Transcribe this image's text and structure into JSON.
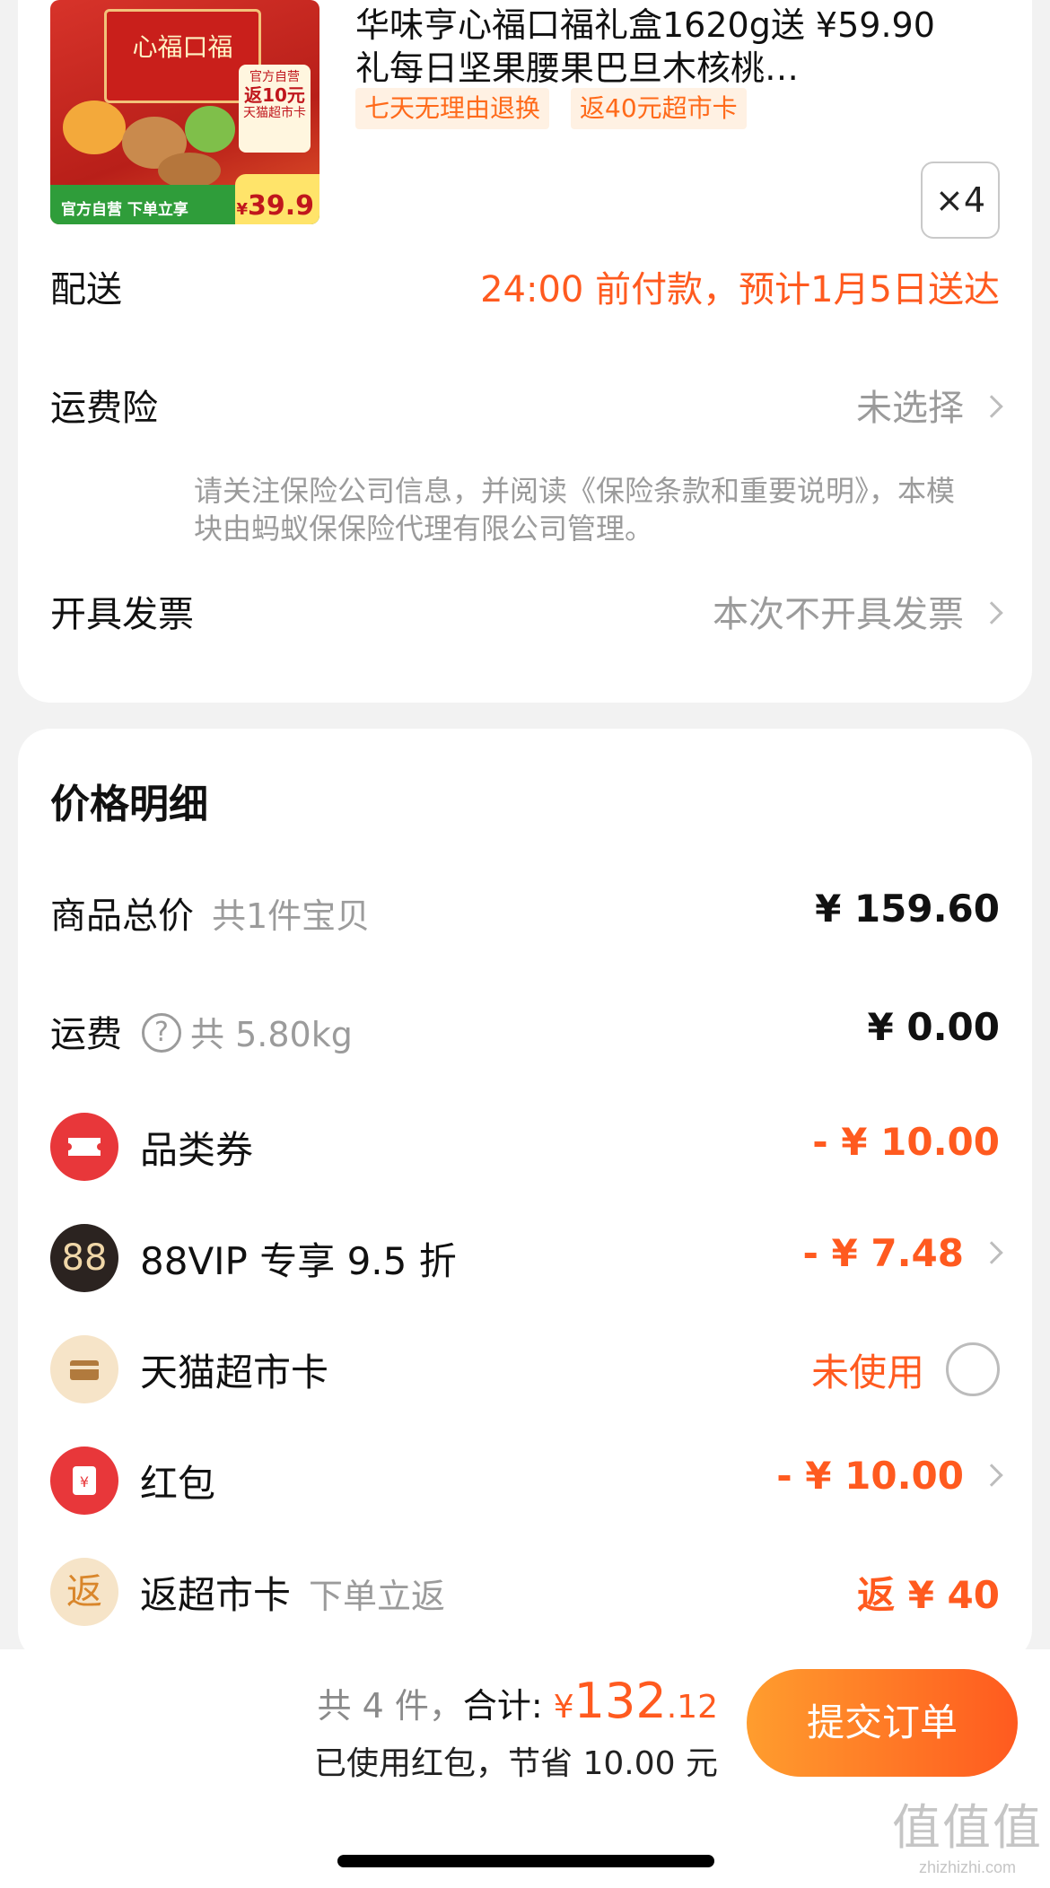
{
  "product": {
    "title_line1": "华味亨心福口福礼盒1620g送 ¥59.90",
    "title_line2": "礼每日坚果腰果巴旦木核桃…",
    "tags": [
      "七天无理由退换",
      "返40元超市卡"
    ],
    "quantity": "×4",
    "image": {
      "box_text": "心福口福",
      "badge_line1": "官方自营",
      "badge_line2": "返10元",
      "badge_line3": "天猫超市卡",
      "banner": "官方自营 下单立享",
      "price": "39.9",
      "currency": "¥"
    }
  },
  "delivery": {
    "label": "配送",
    "value": "24:00 前付款，预计1月5日送达"
  },
  "insurance": {
    "label": "运费险",
    "value": "未选择",
    "note": "请关注保险公司信息，并阅读《保险条款和重要说明》，本模块由蚂蚁保保险代理有限公司管理。"
  },
  "invoice": {
    "label": "开具发票",
    "value": "本次不开具发票"
  },
  "price_detail": {
    "title": "价格明细",
    "goods_total": {
      "label": "商品总价",
      "sub": "共1件宝贝",
      "value": "¥ 159.60"
    },
    "shipping": {
      "label": "运费",
      "sub": "共 5.80kg",
      "value": "¥ 0.00"
    },
    "rows": [
      {
        "label": "品类券",
        "value": "- ¥ 10.00",
        "icon": "ticket-icon"
      },
      {
        "label": "88VIP 专享 9.5 折",
        "value": "- ¥ 7.48",
        "icon": "88vip-icon",
        "icon_text": "88"
      },
      {
        "label": "天猫超市卡",
        "value": "未使用",
        "icon": "card-icon"
      },
      {
        "label": "红包",
        "value": "- ¥ 10.00",
        "icon": "red-packet-icon",
        "icon_text": "¥"
      },
      {
        "label": "返超市卡",
        "sub": "下单立返",
        "value": "返 ¥ 40",
        "icon": "rebate-icon",
        "icon_text": "返"
      }
    ]
  },
  "footer": {
    "count_text": "共 4 件，",
    "total_label": "合计:",
    "currency": "¥",
    "total_int": "132",
    "total_dec": ".12",
    "save_text": "已使用红包，节省 10.00 元",
    "submit_label": "提交订单"
  },
  "watermark": {
    "big": "值值值",
    "small": "zhizhizhi.com"
  },
  "colors": {
    "accent": "#ff5a1f",
    "button_start": "#ff9d2e",
    "button_end": "#ff5a1f"
  }
}
